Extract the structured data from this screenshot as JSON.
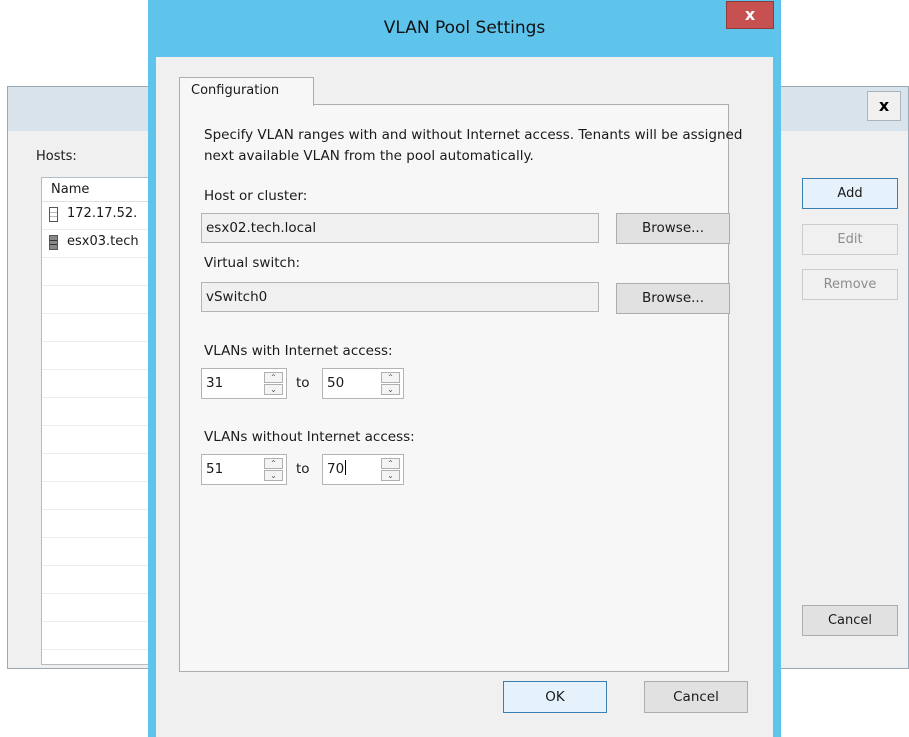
{
  "background_window": {
    "close_label": "x",
    "hosts_label": "Hosts:",
    "list_header": "Name",
    "hosts": [
      "172.17.52.",
      "esx03.tech"
    ],
    "buttons": {
      "add": "Add",
      "edit": "Edit",
      "remove": "Remove",
      "cancel": "Cancel"
    }
  },
  "dialog": {
    "title": "VLAN Pool Settings",
    "close_label": "x",
    "tab_label": "Configuration",
    "description": "Specify VLAN ranges with and without Internet access. Tenants will be assigned next available VLAN from the pool automatically.",
    "host_label": "Host or cluster:",
    "host_value": "esx02.tech.local",
    "switch_label": "Virtual switch:",
    "switch_value": "vSwitch0",
    "browse_label": "Browse...",
    "with_internet_label": "VLANs with Internet access:",
    "with_from": "31",
    "with_to": "50",
    "without_internet_label": "VLANs without Internet access:",
    "without_from": "51",
    "without_to": "70",
    "to_label": "to",
    "ok_label": "OK",
    "cancel_label": "Cancel"
  },
  "icons": {
    "spin_up": "chevron-up-icon",
    "spin_down": "chevron-down-icon",
    "host": "server-icon"
  },
  "colors": {
    "title_bar": "#5ec4ec",
    "close_button": "#c75050"
  }
}
